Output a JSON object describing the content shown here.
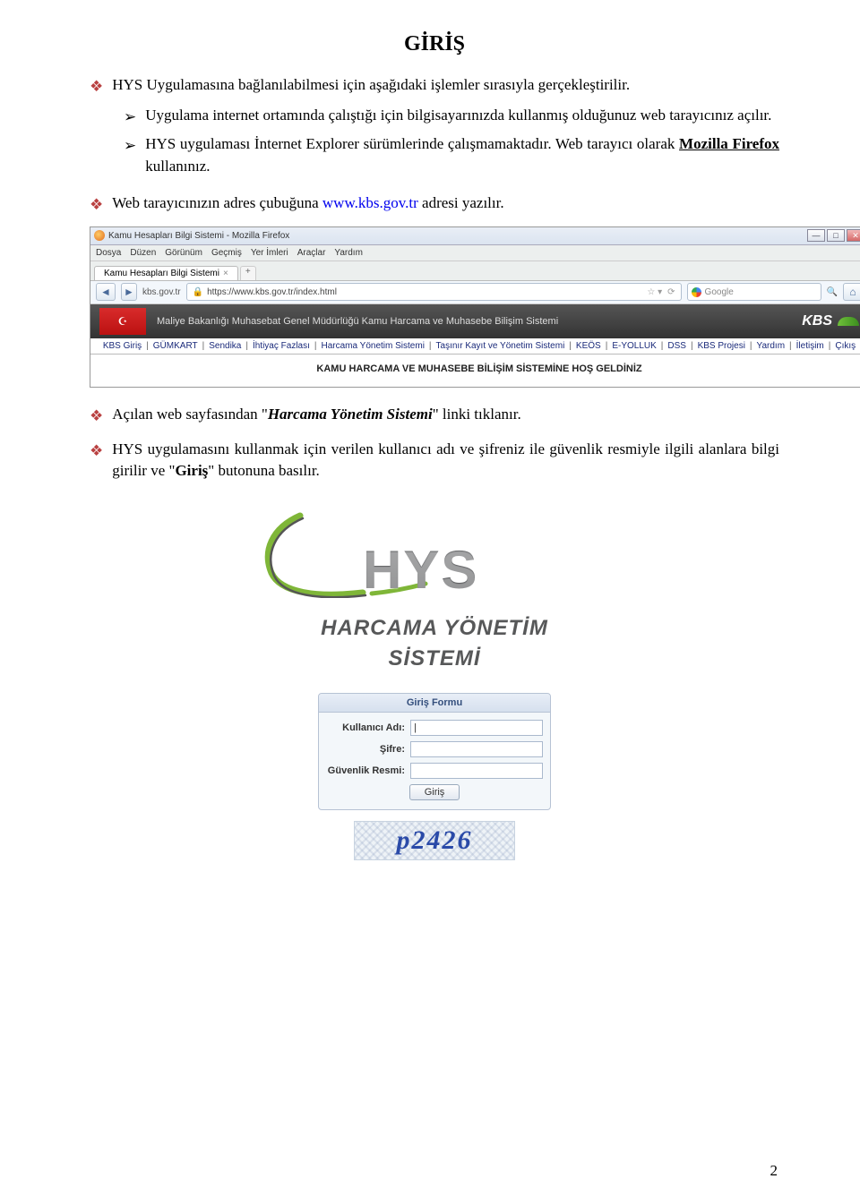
{
  "title": "GİRİŞ",
  "bullets": {
    "b1_text": "HYS Uygulamasına bağlanılabilmesi için aşağıdaki işlemler sırasıyla gerçekleştirilir.",
    "arrows": {
      "a1": "Uygulama internet ortamında çalıştığı için bilgisayarınızda kullanmış olduğunuz web tarayıcınız açılır.",
      "a2_pre": "HYS uygulaması İnternet Explorer sürümlerinde çalışmamaktadır. Web tarayıcı olarak ",
      "a2_em": "Mozilla Firefox",
      "a2_post": " kullanınız."
    },
    "b2_pre": "Web tarayıcınızın adres çubuğuna ",
    "b2_link": "www.kbs.gov.tr",
    "b2_post": " adresi yazılır.",
    "b3_pre": "Açılan web sayfasından \"",
    "b3_em": "Harcama Yönetim Sistemi",
    "b3_post": "\" linki tıklanır.",
    "b4_pre": "HYS uygulamasını kullanmak için verilen kullanıcı adı ve şifreniz ile güvenlik resmiyle ilgili alanlara bilgi girilir ve \"",
    "b4_em": "Giriş",
    "b4_post": "\" butonuna basılır."
  },
  "browser": {
    "window_title": "Kamu Hesapları Bilgi Sistemi - Mozilla Firefox",
    "menus": [
      "Dosya",
      "Düzen",
      "Görünüm",
      "Geçmiş",
      "Yer İmleri",
      "Araçlar",
      "Yardım"
    ],
    "tab_label": "Kamu Hesapları Bilgi Sistemi",
    "nav_domain": "kbs.gov.tr",
    "url": "https://www.kbs.gov.tr/index.html",
    "search_placeholder": "Google",
    "header_text": "Maliye Bakanlığı Muhasebat Genel Müdürlüğü Kamu Harcama ve Muhasebe Bilişim Sistemi",
    "kbs_logo": "KBS",
    "menu_items": [
      "KBS Giriş",
      "GÜMKART",
      "Sendika",
      "İhtiyaç Fazlası",
      "Harcama Yönetim Sistemi",
      "Taşınır Kayıt ve Yönetim Sistemi",
      "KEÖS",
      "E-YOLLUK",
      "DSS",
      "KBS Projesi",
      "Yardım",
      "İletişim",
      "Çıkış"
    ],
    "welcome": "KAMU HARCAMA VE MUHASEBE BİLİŞİM SİSTEMİNE HOŞ GELDİNİZ"
  },
  "hys_logo": {
    "big": "HYS",
    "line1": "HARCAMA YÖNETİM",
    "line2": "SİSTEMİ"
  },
  "login": {
    "header": "Giriş Formu",
    "user_label": "Kullanıcı Adı:",
    "pass_label": "Şifre:",
    "captcha_label": "Güvenlik Resmi:",
    "button": "Giriş",
    "captcha_text": "p2426"
  },
  "page_number": "2"
}
